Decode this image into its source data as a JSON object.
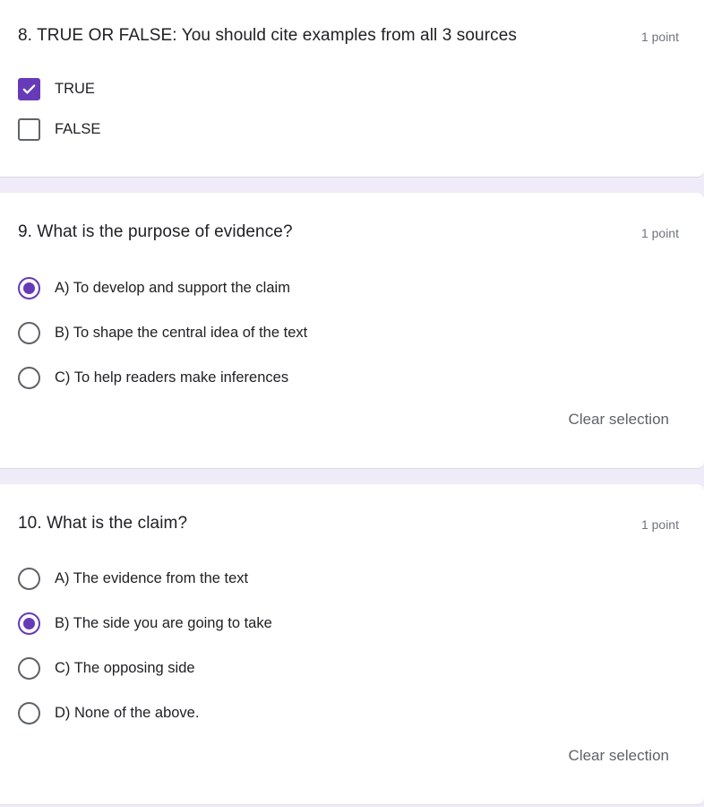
{
  "accent_color": "#673ab7",
  "questions": [
    {
      "number": 8,
      "title": "8. TRUE OR FALSE: You should cite examples from all 3 sources",
      "points": "1 point",
      "type": "checkbox",
      "options": [
        {
          "label": "TRUE",
          "checked": true
        },
        {
          "label": "FALSE",
          "checked": false
        }
      ]
    },
    {
      "number": 9,
      "title": "9. What is the purpose of evidence?",
      "points": "1 point",
      "type": "radio",
      "options": [
        {
          "label": "A) To develop and support the claim",
          "checked": true
        },
        {
          "label": "B) To shape the central idea of the text",
          "checked": false
        },
        {
          "label": "C) To help readers make inferences",
          "checked": false
        }
      ],
      "clear_label": "Clear selection"
    },
    {
      "number": 10,
      "title": "10. What is the claim?",
      "points": "1 point",
      "type": "radio",
      "options": [
        {
          "label": "A) The evidence from the text",
          "checked": false
        },
        {
          "label": "B) The side you are going to take",
          "checked": true
        },
        {
          "label": "C) The opposing side",
          "checked": false
        },
        {
          "label": "D) None of the above.",
          "checked": false
        }
      ],
      "clear_label": "Clear selection"
    }
  ]
}
